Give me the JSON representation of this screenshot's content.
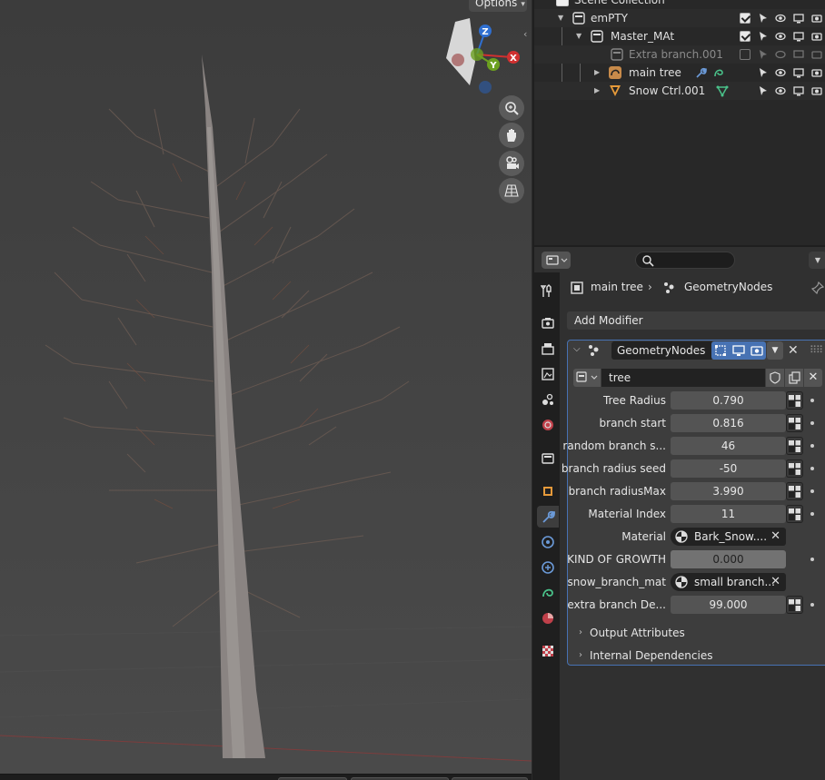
{
  "viewport": {
    "options_label": "Options",
    "gizmo": {
      "axis_z": "Z",
      "axis_y": "Y",
      "axis_x": "X"
    }
  },
  "outliner": {
    "scene_collection": "Scene Collection",
    "rows": [
      {
        "label": "emPTY",
        "type": "collection"
      },
      {
        "label": "Master_MAt",
        "type": "collection"
      },
      {
        "label": "Extra branch.001",
        "type": "collection",
        "disabled": true
      },
      {
        "label": "main tree",
        "type": "object"
      },
      {
        "label": "Snow Ctrl.001",
        "type": "object"
      }
    ]
  },
  "properties": {
    "breadcrumb": {
      "object": "main tree",
      "modifier": "GeometryNodes"
    },
    "add_modifier_label": "Add Modifier",
    "modifier": {
      "name": "GeometryNodes",
      "node_group": "tree",
      "inputs": [
        {
          "label": "Tree Radius",
          "value": "0.790",
          "kind": "number"
        },
        {
          "label": "branch start",
          "value": "0.816",
          "kind": "number"
        },
        {
          "label": "random branch s...",
          "value": "46",
          "kind": "number"
        },
        {
          "label": "branch radius seed",
          "value": "-50",
          "kind": "number"
        },
        {
          "label": "branch radiusMax",
          "value": "3.990",
          "kind": "number"
        },
        {
          "label": "Material Index",
          "value": "11",
          "kind": "number"
        },
        {
          "label": "Material",
          "value": "Bark_Snow....",
          "kind": "material"
        },
        {
          "label": "KIND OF GROWTH",
          "value": "0.000",
          "kind": "number_dim"
        },
        {
          "label": "snow_branch_mat",
          "value": "small branch...",
          "kind": "material"
        },
        {
          "label": "extra branch De...",
          "value": "99.000",
          "kind": "number"
        }
      ],
      "subpanels": [
        "Output Attributes",
        "Internal Dependencies"
      ]
    }
  },
  "colors": {
    "accent": "#4772b3",
    "panel": "#3d3d3d",
    "field": "#545454"
  }
}
